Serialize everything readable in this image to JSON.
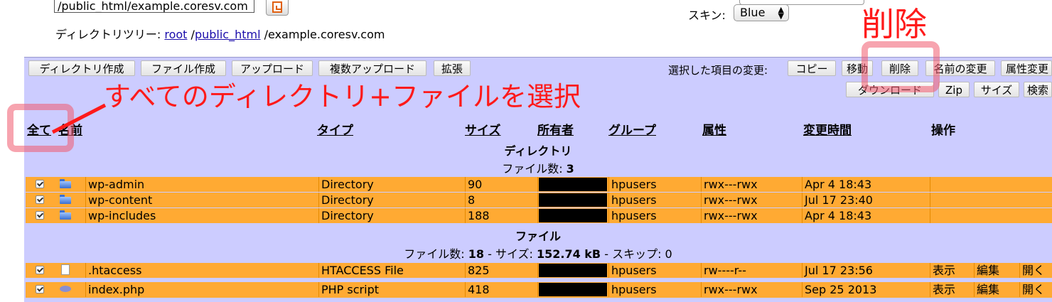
{
  "top": {
    "path_value": "/public_html/example.coresv.com",
    "dirtree_label": "ディレクトリツリー:",
    "dirtree_root": "root",
    "dirtree_sep1": "/",
    "dirtree_public": "public_html",
    "dirtree_rest": "/example.coresv.com",
    "skin_label": "スキン:",
    "skin_value": "Blue"
  },
  "toolbar": {
    "left_buttons": [
      "ディレクトリ作成",
      "ファイル作成",
      "アップロード",
      "複数アップロード",
      "拡張"
    ],
    "selected_label": "選択した項目の変更:",
    "right_buttons": [
      "コピー",
      "移動",
      "削除",
      "名前の変更",
      "属性変更"
    ],
    "right_buttons_row2": [
      "ダウンロード",
      "Zip",
      "サイズ",
      "検索"
    ]
  },
  "columns": {
    "all": "全て",
    "name": "名前",
    "type": "タイプ",
    "size": "サイズ",
    "owner": "所有者",
    "group": "グループ",
    "perms": "属性",
    "mtime": "変更時間",
    "actions": "操作"
  },
  "directories": {
    "title": "ディレクトリ",
    "count_label": "ファイル数: ",
    "count": "3",
    "rows": [
      {
        "name": "wp-admin",
        "type": "Directory",
        "size": "90",
        "group": "hpusers",
        "perms": "rwx---rwx",
        "mtime": "Apr 4 18:43"
      },
      {
        "name": "wp-content",
        "type": "Directory",
        "size": "8",
        "group": "hpusers",
        "perms": "rwx---rwx",
        "mtime": "Jul 17 23:40"
      },
      {
        "name": "wp-includes",
        "type": "Directory",
        "size": "188",
        "group": "hpusers",
        "perms": "rwx---rwx",
        "mtime": "Apr 4 18:43"
      }
    ]
  },
  "files": {
    "title": "ファイル",
    "count_label": "ファイル数: ",
    "count": "18",
    "size_label": " - サイズ: ",
    "size": "152.74 kB",
    "skip_label": " - スキップ: 0",
    "rows": [
      {
        "name": ".htaccess",
        "type": "HTACCESS File",
        "size": "825",
        "group": "hpusers",
        "perms": "rw----r--",
        "mtime": "Jul 17 23:56",
        "view": "表示",
        "edit": "編集",
        "open": "開く"
      },
      {
        "name": "index.php",
        "type": "PHP script",
        "size": "418",
        "group": "hpusers",
        "perms": "rwx---rwx",
        "mtime": "Sep 25 2013",
        "view": "表示",
        "edit": "編集",
        "open": "開く"
      }
    ]
  },
  "annotations": {
    "delete_text": "削除",
    "select_all_text": "すべてのディレクトリ+ファイルを選択",
    "color": "#ff1a1a"
  }
}
